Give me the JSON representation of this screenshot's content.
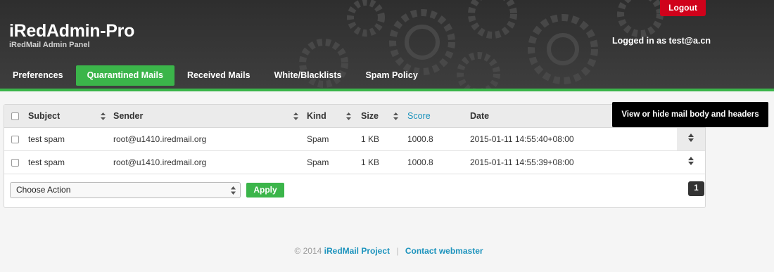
{
  "header": {
    "title": "iRedAdmin-Pro",
    "subtitle": "iRedMail Admin Panel",
    "logout_label": "Logout",
    "logged_in_text": "Logged in as test@a.cn"
  },
  "tabs": [
    {
      "label": "Preferences",
      "active": false
    },
    {
      "label": "Quarantined Mails",
      "active": true
    },
    {
      "label": "Received Mails",
      "active": false
    },
    {
      "label": "White/Blacklists",
      "active": false
    },
    {
      "label": "Spam Policy",
      "active": false
    }
  ],
  "table": {
    "columns": [
      "Subject",
      "Sender",
      "Kind",
      "Size",
      "Score",
      "Date"
    ],
    "rows": [
      {
        "subject": "test spam",
        "sender": "root@u1410.iredmail.org",
        "kind": "Spam",
        "size": "1 KB",
        "score": "1000.8",
        "date": "2015-01-11 14:55:40+08:00"
      },
      {
        "subject": "test spam",
        "sender": "root@u1410.iredmail.org",
        "kind": "Spam",
        "size": "1 KB",
        "score": "1000.8",
        "date": "2015-01-11 14:55:39+08:00"
      }
    ]
  },
  "tooltip": "View or hide mail body and headers",
  "actions": {
    "select_value": "Choose Action",
    "apply_label": "Apply",
    "page_number": "1"
  },
  "footer": {
    "copyright": "© 2014",
    "project_link": "iRedMail Project",
    "separator": "|",
    "contact_link": "Contact webmaster"
  },
  "colors": {
    "accent_green": "#3bb54a",
    "logout_red": "#d0021b",
    "link_blue": "#1c93bd",
    "header_dark": "#3a3a3a"
  }
}
